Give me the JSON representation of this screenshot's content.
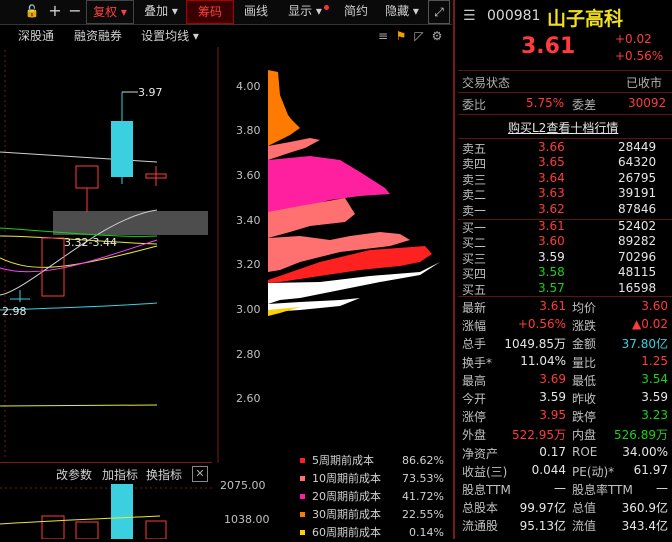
{
  "toolbar": {
    "buttons": [
      "复权",
      "叠加",
      "筹码",
      "画线",
      "显示",
      "简约",
      "隐藏"
    ],
    "sub": [
      "深股通",
      "融资融券",
      "设置均线"
    ]
  },
  "price_axis": [
    "4.00",
    "3.80",
    "3.60",
    "3.40",
    "3.20",
    "3.00",
    "2.80",
    "2.60"
  ],
  "chart_labels": {
    "high": "3.97",
    "low": "2.98",
    "range": "3.32-3.44"
  },
  "vol_panel": {
    "labels": [
      "改参数",
      "加指标",
      "换指标"
    ],
    "axis": [
      "2075.00",
      "1038.00"
    ]
  },
  "legend": [
    {
      "label": "5周期前成本",
      "value": "86.62%",
      "color": "#ff2020"
    },
    {
      "label": "10周期前成本",
      "value": "73.53%",
      "color": "#ff7070"
    },
    {
      "label": "20周期前成本",
      "value": "41.72%",
      "color": "#ff20a0"
    },
    {
      "label": "30周期前成本",
      "value": "22.55%",
      "color": "#ff7a00"
    },
    {
      "label": "60周期前成本",
      "value": "0.14%",
      "color": "#ffd000"
    }
  ],
  "quote": {
    "code": "000981",
    "name": "山子高科",
    "price": "3.61",
    "change": "+0.02",
    "pct": "+0.56%",
    "status_label": "交易状态",
    "status": "已收市",
    "weibi_label": "委比",
    "weibi": "5.75%",
    "weicha_label": "委差",
    "weicha": "30092",
    "l2_link": "购买L2查看十档行情"
  },
  "asks": [
    {
      "label": "卖五",
      "price": "3.66",
      "vol": "28449"
    },
    {
      "label": "卖四",
      "price": "3.65",
      "vol": "64320"
    },
    {
      "label": "卖三",
      "price": "3.64",
      "vol": "26795"
    },
    {
      "label": "卖二",
      "price": "3.63",
      "vol": "39191"
    },
    {
      "label": "卖一",
      "price": "3.62",
      "vol": "87846"
    }
  ],
  "bids": [
    {
      "label": "买一",
      "price": "3.61",
      "vol": "52402",
      "color": "#ff3b3b"
    },
    {
      "label": "买二",
      "price": "3.60",
      "vol": "89282",
      "color": "#ff3b3b"
    },
    {
      "label": "买三",
      "price": "3.59",
      "vol": "70296",
      "color": "#e6e6e6"
    },
    {
      "label": "买四",
      "price": "3.58",
      "vol": "48115",
      "color": "#19d219"
    },
    {
      "label": "买五",
      "price": "3.57",
      "vol": "16598",
      "color": "#19d219"
    }
  ],
  "stats": [
    {
      "l1": "最新",
      "v1": "3.61",
      "c1": "#ff3b3b",
      "l2": "均价",
      "v2": "3.60",
      "c2": "#ff3b3b"
    },
    {
      "l1": "涨幅",
      "v1": "+0.56%",
      "c1": "#ff3b3b",
      "l2": "涨跌",
      "v2": "▲0.02",
      "c2": "#ff3b3b"
    },
    {
      "l1": "总手",
      "v1": "1049.85万",
      "c1": "#e6e6e6",
      "l2": "金额",
      "v2": "37.80亿",
      "c2": "#3ad0e0"
    },
    {
      "l1": "换手*",
      "v1": "11.04%",
      "c1": "#e6e6e6",
      "l2": "量比",
      "v2": "1.25",
      "c2": "#ff3b3b"
    },
    {
      "l1": "最高",
      "v1": "3.69",
      "c1": "#ff3b3b",
      "l2": "最低",
      "v2": "3.54",
      "c2": "#19d219"
    },
    {
      "l1": "今开",
      "v1": "3.59",
      "c1": "#e6e6e6",
      "l2": "昨收",
      "v2": "3.59",
      "c2": "#e6e6e6"
    },
    {
      "l1": "涨停",
      "v1": "3.95",
      "c1": "#ff3b3b",
      "l2": "跌停",
      "v2": "3.23",
      "c2": "#19d219"
    },
    {
      "l1": "外盘",
      "v1": "522.95万",
      "c1": "#ff3b3b",
      "l2": "内盘",
      "v2": "526.89万",
      "c2": "#19d219"
    },
    {
      "l1": "净资产",
      "v1": "0.17",
      "c1": "#e6e6e6",
      "l2": "ROE",
      "v2": "34.00%",
      "c2": "#e6e6e6"
    },
    {
      "l1": "收益(三)",
      "v1": "0.044",
      "c1": "#e6e6e6",
      "l2": "PE(动)*",
      "v2": "61.97",
      "c2": "#e6e6e6"
    },
    {
      "l1": "股息TTM",
      "v1": "—",
      "c1": "#e6e6e6",
      "l2": "股息率TTM",
      "v2": "—",
      "c2": "#e6e6e6"
    },
    {
      "l1": "总股本",
      "v1": "99.97亿",
      "c1": "#e6e6e6",
      "l2": "总值",
      "v2": "360.9亿",
      "c2": "#e6e6e6"
    },
    {
      "l1": "流通股",
      "v1": "95.13亿",
      "c1": "#e6e6e6",
      "l2": "流值",
      "v2": "343.4亿",
      "c2": "#e6e6e6"
    }
  ]
}
